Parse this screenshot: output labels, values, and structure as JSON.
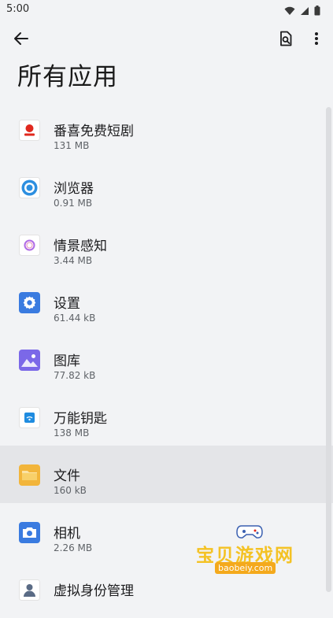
{
  "status_bar": {
    "time": "5:00",
    "icons": [
      "wifi-icon",
      "signal-icon",
      "battery-icon"
    ]
  },
  "toolbar": {
    "back_icon": "arrow-back-icon",
    "search_icon": "app-search-icon",
    "more_icon": "more-vert-icon"
  },
  "page": {
    "title": "所有应用"
  },
  "apps": [
    {
      "name": "番喜免费短剧",
      "size": "131 MB",
      "icon": "fanxi-icon"
    },
    {
      "name": "浏览器",
      "size": "0.91 MB",
      "icon": "browser-icon"
    },
    {
      "name": "情景感知",
      "size": "3.44 MB",
      "icon": "context-awareness-icon"
    },
    {
      "name": "设置",
      "size": "61.44 kB",
      "icon": "settings-gear-icon"
    },
    {
      "name": "图库",
      "size": "77.82 kB",
      "icon": "gallery-icon"
    },
    {
      "name": "万能钥匙",
      "size": "138 MB",
      "icon": "wifi-key-icon"
    },
    {
      "name": "文件",
      "size": "160 kB",
      "icon": "folder-icon"
    },
    {
      "name": "相机",
      "size": "2.26 MB",
      "icon": "camera-icon"
    },
    {
      "name": "虚拟身份管理",
      "size": "",
      "icon": "virtual-identity-icon"
    }
  ],
  "watermark": {
    "text": "宝贝游戏网",
    "url": "baobeiy.com"
  },
  "colors": {
    "background": "#f2f3f5",
    "active_row": "#e4e5e8",
    "accent_blue": "#3a7be0",
    "watermark_yellow": "#f4c224"
  }
}
